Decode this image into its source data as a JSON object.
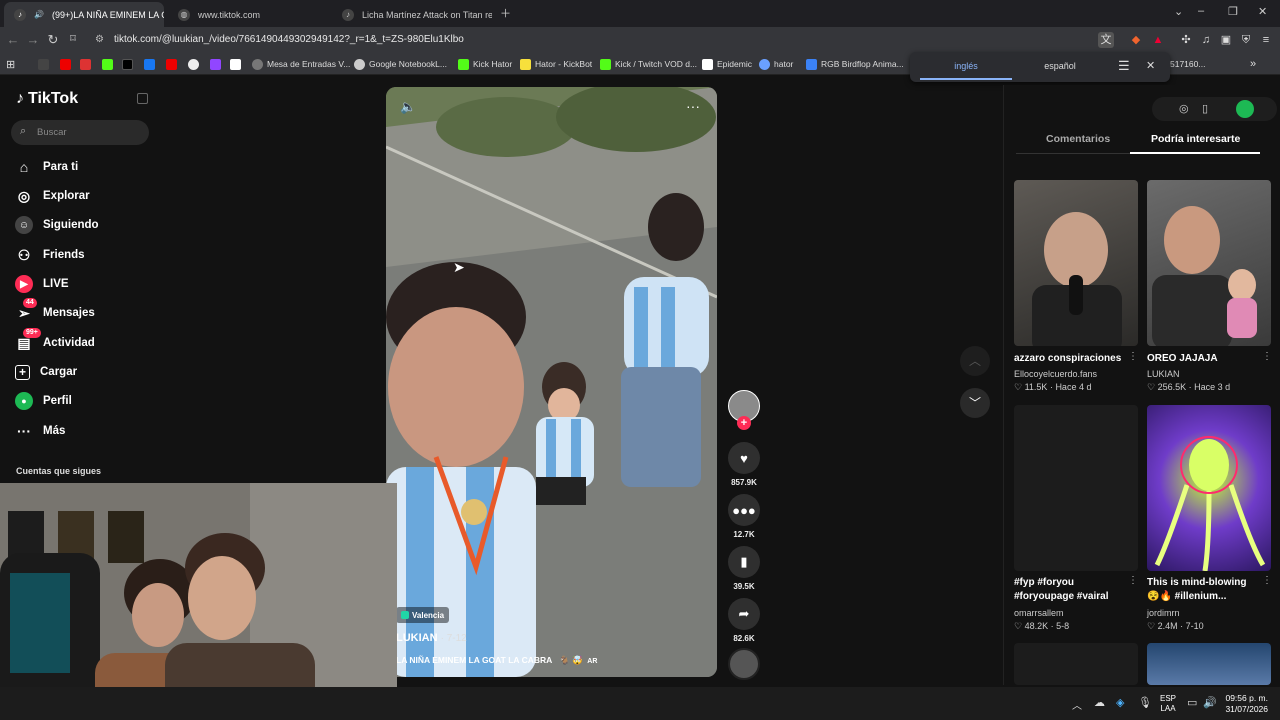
{
  "browser": {
    "tabs": [
      {
        "title": "(99+)LA NIÑA EMINEM LA GOAT",
        "active": true
      },
      {
        "title": "www.tiktok.com",
        "active": false
      },
      {
        "title": "Licha Martínez Attack on Titan refere",
        "active": false
      }
    ],
    "url": "tiktok.com/@luukian_/video/7661490449302949142?_r=1&_t=ZS-980Elu1Klbo",
    "bookmarks": [
      "Mesa de Entradas V...",
      "Google NotebookL...",
      "Kick Hator",
      "Hator - KickBot",
      "Kick / Twitch VOD d...",
      "Epidemic",
      "hator",
      "RGB Birdflop Anima...",
      "517160..."
    ],
    "translate": {
      "lang1": "inglés",
      "lang2": "español"
    }
  },
  "sidebar": {
    "logo": "TikTok",
    "search_placeholder": "Buscar",
    "items": [
      {
        "label": "Para ti",
        "icon": "home-icon"
      },
      {
        "label": "Explorar",
        "icon": "compass-icon"
      },
      {
        "label": "Siguiendo",
        "icon": "following-icon"
      },
      {
        "label": "Friends",
        "icon": "friends-icon"
      },
      {
        "label": "LIVE",
        "icon": "live-icon"
      },
      {
        "label": "Mensajes",
        "icon": "messages-icon",
        "badge": "44"
      },
      {
        "label": "Actividad",
        "icon": "activity-icon",
        "badge": "99+"
      },
      {
        "label": "Cargar",
        "icon": "upload-icon"
      },
      {
        "label": "Perfil",
        "icon": "profile-icon"
      },
      {
        "label": "Más",
        "icon": "more-icon"
      }
    ],
    "following_heading": "Cuentas que sigues"
  },
  "video": {
    "location": "Valencia",
    "author": "LUKIAN",
    "date": "· 7-12",
    "caption": "LA NIÑA EMINEM LA GOAT LA CABRA",
    "caption_tag": "AR"
  },
  "actions": {
    "likes": "857.9K",
    "comments": "12.7K",
    "saves": "39.5K",
    "shares": "82.6K"
  },
  "panel": {
    "tabs": [
      "Comentarios",
      "Podría interesarte"
    ],
    "active_tab": 1,
    "cards": [
      {
        "title": "azzaro conspiraciones",
        "author": "Ellocoyelcuerdo.fans",
        "likes": "11.5K",
        "time": "Hace 4 d"
      },
      {
        "title": "OREO JAJAJA",
        "author": "LUKIAN",
        "likes": "256.5K",
        "time": "Hace 3 d"
      },
      {
        "title": "#fyp #foryou #foryoupage #vairal",
        "author": "omarrsallem",
        "likes": "48.2K",
        "time": "5-8"
      },
      {
        "title": "This is mind-blowing 😵🔥 #illenium...",
        "author": "jordimrn",
        "likes": "2.4M",
        "time": "7-10"
      }
    ]
  },
  "taskbar": {
    "lang": "ESP",
    "layout": "LAA",
    "time": "09:56 p. m.",
    "date": "31/07/2026"
  },
  "colors": {
    "accent": "#fe2c55",
    "teal": "#25f4ee",
    "bg": "#121212"
  }
}
